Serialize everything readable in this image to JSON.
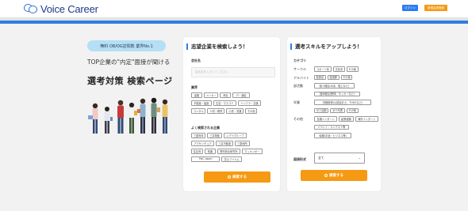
{
  "header": {
    "brand": "Voice Career",
    "login_label": "ログイン",
    "register_label": "新規会員登録"
  },
  "hero": {
    "badge": "無料 OB/OG訪問数 業界No.1",
    "subtitle": "TOP企業の\"内定\"面接が聞ける",
    "title": "選考対策 検索ページ"
  },
  "company_search": {
    "title": "志望企業を検索しよう！",
    "company_name_label": "会社名",
    "company_name_placeholder": "会社名を入力してください",
    "industry_label": "業界",
    "industries": [
      [
        "金融",
        "メーカー",
        "商社",
        "IT・通信"
      ],
      [
        "不動産・建設",
        "広告・マスコミ",
        "インフラ・交通"
      ],
      [
        "コンサル",
        "人材・教育",
        "小売・流通",
        "その他"
      ]
    ],
    "popular_label": "よく検索される企業",
    "popular": [
      [
        "三菱商事",
        "三井物産",
        "レデイグループ"
      ],
      [
        "アクセンチュア",
        "三井不動産",
        "三菱地所"
      ],
      [
        "住友商",
        "電通",
        "野村総合研究所",
        "マッキンゼー"
      ],
      [
        "PwC Japan",
        "富士フイルム"
      ]
    ],
    "search_label": "検索する"
  },
  "skill_search": {
    "title": "選考スキルをアップしよう！",
    "category_label": "カテゴリ",
    "rows": [
      {
        "label": "サークル",
        "chips": [
          "スポーツ系",
          "文化系",
          "その他"
        ]
      },
      {
        "label": "アルバイト",
        "chips": [
          "飲食店",
          "塾講師",
          "その他"
        ]
      },
      {
        "label": "部活動",
        "chips": [
          "個人種目(水泳、陸上など)"
        ]
      },
      {
        "label": "",
        "chips": [
          "団体種目(野球、サッカーなど)"
        ]
      },
      {
        "label": "学業",
        "chips": [
          "資格取得(公認会計士、TOEICなど)"
        ]
      },
      {
        "label": "",
        "chips": [
          "ゼミ活動",
          "ゼミ代表",
          "その他"
        ]
      },
      {
        "label": "その他",
        "chips": [
          "長期インターン",
          "起業経験",
          "海外インターン"
        ]
      },
      {
        "label": "",
        "chips": [
          "イベント・コンテスト等"
        ]
      },
      {
        "label": "",
        "chips": [
          "転職(中途・ビジネス等)"
        ]
      }
    ],
    "format_label": "面接形式",
    "format_value": "全て",
    "search_label": "検索する"
  }
}
